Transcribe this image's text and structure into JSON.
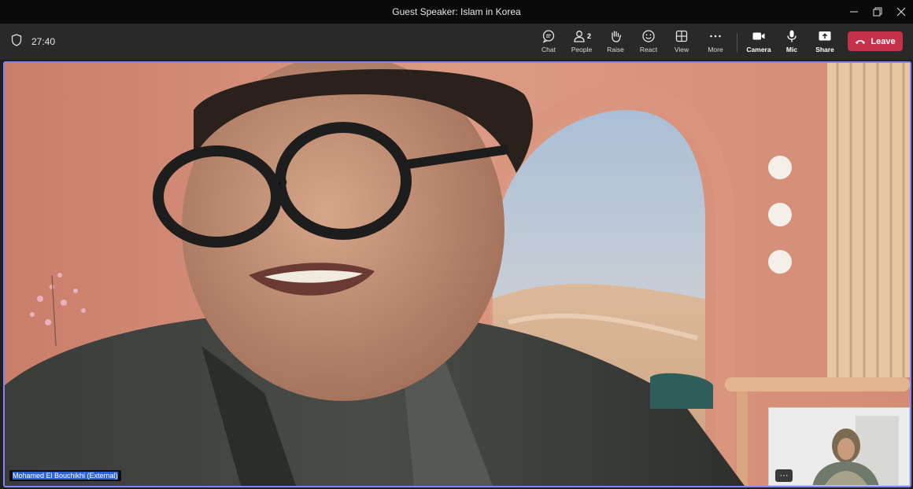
{
  "window": {
    "title": "Guest Speaker: Islam in Korea",
    "controls": [
      "minimize-icon",
      "restore-icon",
      "close-icon"
    ]
  },
  "meeting": {
    "timer": "27:40",
    "toolbar": {
      "chat": "Chat",
      "people": "People",
      "people_count": "2",
      "raise": "Raise",
      "react": "React",
      "view": "View",
      "more": "More",
      "camera": "Camera",
      "mic": "Mic",
      "share": "Share",
      "leave": "Leave"
    },
    "speaker_name": "Mohamed El Bouchikhi (External)",
    "self_view_more": "···"
  },
  "colors": {
    "leave": "#c4314b",
    "active_border": "#7f85f5",
    "name_highlight": "#2f63d4"
  }
}
